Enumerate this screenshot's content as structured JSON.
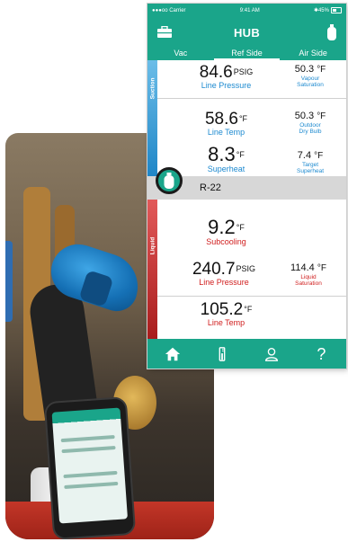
{
  "status_bar": {
    "carrier": "●●●oo Carrier",
    "time": "9:41 AM",
    "battery": "45%"
  },
  "header": {
    "title": "HUB"
  },
  "tabs": [
    {
      "label": "Vac",
      "active": false
    },
    {
      "label": "Ref Side",
      "active": true
    },
    {
      "label": "Air Side",
      "active": false
    }
  ],
  "suction": {
    "section_label": "Suction",
    "line_pressure": {
      "value": "84.6",
      "unit": "PSIG",
      "label": "Line Pressure"
    },
    "vapour_saturation": {
      "value": "50.3",
      "unit": "°F",
      "label_line1": "Vapour",
      "label_line2": "Saturation"
    },
    "line_temp": {
      "value": "58.6",
      "unit": "°F",
      "label": "Line Temp"
    },
    "outdoor_dry_bulb": {
      "value": "50.3",
      "unit": "°F",
      "label_line1": "Outdoor",
      "label_line2": "Dry Bulb"
    },
    "superheat": {
      "value": "8.3",
      "unit": "°F",
      "label": "Superheat"
    },
    "target_superheat": {
      "value": "7.4",
      "unit": "°F",
      "label_line1": "Target",
      "label_line2": "Superheat"
    }
  },
  "refrigerant": {
    "name": "R-22"
  },
  "liquid": {
    "section_label": "Liquid",
    "subcooling": {
      "value": "9.2",
      "unit": "°F",
      "label": "Subcooling"
    },
    "line_pressure": {
      "value": "240.7",
      "unit": "PSIG",
      "label": "Line Pressure"
    },
    "liquid_saturation": {
      "value": "114.4",
      "unit": "°F",
      "label_line1": "Liquid",
      "label_line2": "Saturation"
    },
    "line_temp": {
      "value": "105.2",
      "unit": "°F",
      "label": "Line Temp"
    }
  },
  "colors": {
    "accent": "#1aa58a",
    "suction": "#1d8ad0",
    "liquid": "#d01e1e"
  },
  "icons": [
    "toolbox-icon",
    "tank-icon",
    "home-icon",
    "thermometer-icon",
    "user-icon",
    "help-icon"
  ]
}
